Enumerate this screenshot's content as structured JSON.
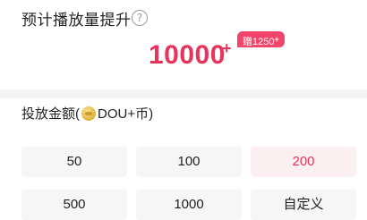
{
  "estimate": {
    "title": "预计播放量提升",
    "help_icon": "?",
    "value": "10000",
    "value_suffix": "+",
    "bonus_text": "赠1250",
    "bonus_suffix": "+"
  },
  "amount": {
    "label_prefix": "投放金额(",
    "coin_icon": "dou-coin-icon",
    "label_suffix": "DOU+币)",
    "options": [
      "50",
      "100",
      "200",
      "500",
      "1000",
      "自定义"
    ],
    "selected": "200"
  },
  "colors": {
    "accent": "#e8335a",
    "selected_bg": "#fdf0f2",
    "option_bg": "#f6f6f6"
  }
}
